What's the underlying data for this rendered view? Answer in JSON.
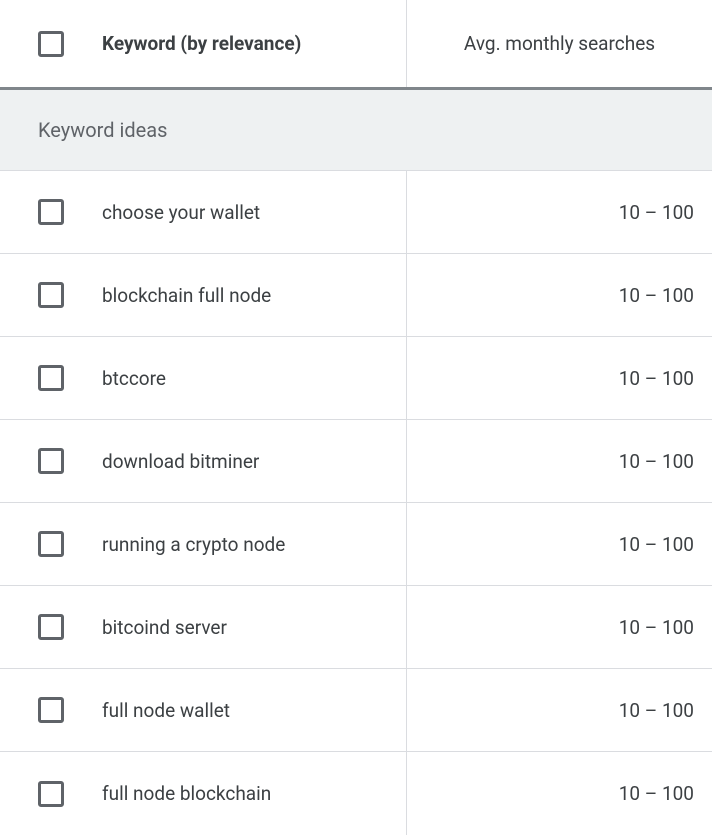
{
  "header": {
    "keyword_label": "Keyword (by relevance)",
    "searches_label": "Avg. monthly searches"
  },
  "section_title": "Keyword ideas",
  "rows": [
    {
      "keyword": "choose your wallet",
      "searches": "10 – 100"
    },
    {
      "keyword": "blockchain full node",
      "searches": "10 – 100"
    },
    {
      "keyword": "btccore",
      "searches": "10 – 100"
    },
    {
      "keyword": "download bitminer",
      "searches": "10 – 100"
    },
    {
      "keyword": "running a crypto node",
      "searches": "10 – 100"
    },
    {
      "keyword": "bitcoind server",
      "searches": "10 – 100"
    },
    {
      "keyword": "full node wallet",
      "searches": "10 – 100"
    },
    {
      "keyword": "full node blockchain",
      "searches": "10 – 100"
    }
  ]
}
